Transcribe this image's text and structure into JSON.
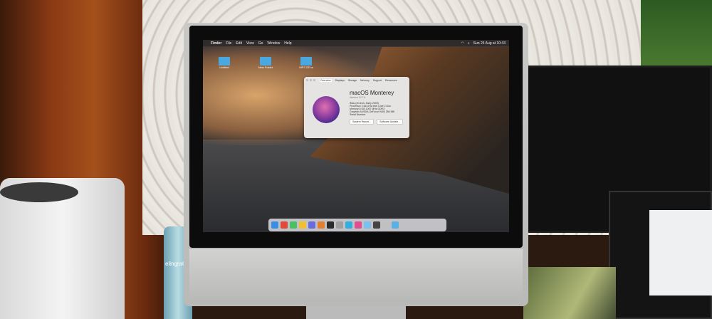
{
  "menubar": {
    "apple": "",
    "items": [
      "Finder",
      "File",
      "Edit",
      "View",
      "Go",
      "Window",
      "Help"
    ],
    "clock": "Sun 24 Aug at 10:43"
  },
  "desktop": {
    "folders": [
      "Untitled",
      "New Folder",
      "MP3 DE.ta"
    ]
  },
  "about": {
    "tabs": [
      "Overview",
      "Displays",
      "Storage",
      "Memory",
      "Support",
      "Resources"
    ],
    "os_name": "macOS Monterey",
    "version": "Version 12.7.6",
    "specs": [
      "iMac (20-inch, Early 2009)",
      "Processor 2.66 GHz Intel Core 2 Duo",
      "Memory 8 GB 1067 MHz DDR3",
      "Graphics NVIDIA GeForce 9400 256 MB",
      "Serial Number"
    ],
    "buttons": [
      "System Report...",
      "Software Update..."
    ]
  },
  "dock_colors": [
    "#3a8ee6",
    "#e04a3a",
    "#4ac060",
    "#f0c030",
    "#6a6ae0",
    "#e08030",
    "#2a2a2a",
    "#a0a0a0",
    "#30b0e0",
    "#e05090",
    "#7ac0f0",
    "#444",
    "#c0c0c0",
    "#5ab0e0"
  ],
  "bottle_label": "elingraC"
}
